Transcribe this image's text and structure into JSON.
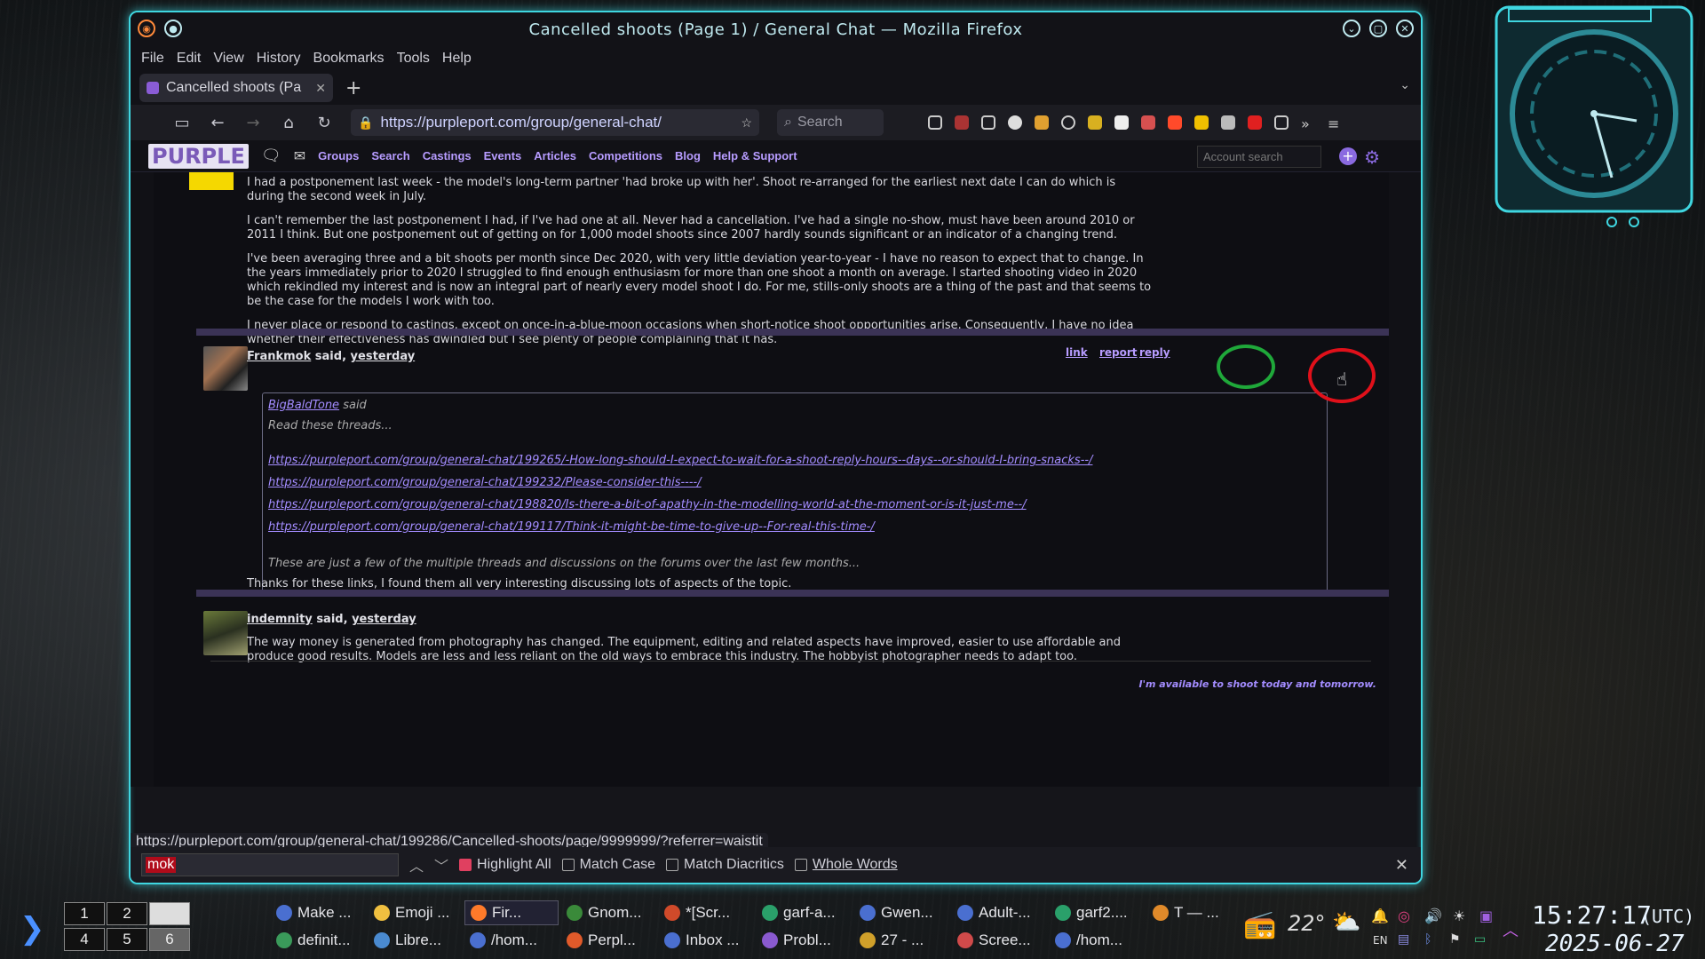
{
  "window": {
    "title": "Cancelled shoots (Page 1) / General Chat — Mozilla Firefox",
    "menu": [
      "File",
      "Edit",
      "View",
      "History",
      "Bookmarks",
      "Tools",
      "Help"
    ],
    "tab_label": "Cancelled shoots (Pa",
    "url": "https://purpleport.com/group/general-chat/",
    "search_placeholder": "Search"
  },
  "site": {
    "logo": "PURPLE",
    "nav": [
      "Groups",
      "Search",
      "Castings",
      "Events",
      "Articles",
      "Competitions",
      "Blog",
      "Help & Support"
    ],
    "account_search_placeholder": "Account search"
  },
  "post1": {
    "paragraphs": [
      "I had a postponement last week - the model's long-term partner 'had broke up with her'. Shoot re-arranged for the earliest next date I can do which is during the second week in July.",
      "I can't remember the last postponement I had, if I've had one at all. Never had a cancellation. I've had a single no-show, must have been around 2010 or 2011 I think. But one postponement out of getting on for 1,000 model shoots since 2007 hardly sounds significant or an indicator of a changing trend.",
      "I've been averaging three and a bit shoots per month since Dec 2020, with very little deviation year-to-year - I have no reason to expect that to change. In the years immediately prior to 2020 I struggled to find enough enthusiasm for more than one shoot a month on average. I started shooting video in 2020 which rekindled my interest and is now an integral part of nearly every model shoot I do. For me, stills-only shoots are a thing of the past and that seems to be the case for the models I work with too.",
      "I never place or respond to castings, except on once-in-a-blue-moon occasions when short-notice shoot opportunities arise. Consequently, I have no idea whether their effectiveness has dwindled but I see plenty of people complaining that it has."
    ]
  },
  "post2": {
    "author": "Frankmok",
    "said": "said,",
    "when": "yesterday",
    "actions": {
      "link": "link",
      "report": "report",
      "reply": "reply"
    },
    "quote": {
      "author": "BigBaldTone",
      "said": "said",
      "intro": "Read these threads...",
      "links": [
        "https://purpleport.com/group/general-chat/199265/-How-long-should-I-expect-to-wait-for-a-shoot-reply-hours--days--or-should-I-bring-snacks--/",
        "https://purpleport.com/group/general-chat/199232/Please-consider-this----/",
        "https://purpleport.com/group/general-chat/198820/Is-there-a-bit-of-apathy-in-the-modelling-world-at-the-moment-or-is-it-just-me--/",
        "https://purpleport.com/group/general-chat/199117/Think-it-might-be-time-to-give-up--For-real-this-time-/"
      ],
      "outro": "These are just a few of the multiple threads and discussions on the forums over the last few months..."
    },
    "body": "Thanks for these links, I found them all very interesting discussing lots of aspects of the topic."
  },
  "post3": {
    "author": "indemnity",
    "said": "said,",
    "when": "yesterday",
    "body": "The way money is generated from photography has changed. The equipment, editing and related aspects have improved, easier to use affordable and produce good results. Models are less and less reliant on the old ways to embrace this industry. The hobbyist photographer needs to adapt too.",
    "signature": "I'm available to shoot today and tomorrow."
  },
  "status_url": "https://purpleport.com/group/general-chat/199286/Cancelled-shoots/page/9999999/?referrer=waistit",
  "findbar": {
    "query": "mok",
    "highlight_all": "Highlight All",
    "match_case": "Match Case",
    "match_diacritics": "Match Diacritics",
    "whole_words": "Whole Words"
  },
  "taskbar": {
    "workspaces": [
      "1",
      "2",
      "",
      "4",
      "5",
      "6"
    ],
    "tasks_row1": [
      "Make ...",
      "Emoji ...",
      "Fir...",
      "Gnom...",
      "*[Scr...",
      "garf-a...",
      "Gwen...",
      "Adult-...",
      "garf2....",
      "T — ..."
    ],
    "tasks_row2": [
      "definit...",
      "Libre...",
      "/hom...",
      "Perpl...",
      "Inbox ...",
      "Probl...",
      "27 - ...",
      "Scree...",
      "/hom..."
    ],
    "weather": "22°",
    "lang": "EN",
    "clock_time": "15:27:17",
    "clock_zone": "(UTC)",
    "clock_date": "2025-06-27"
  },
  "colors": {
    "accent_cyan": "#3fd6e0",
    "site_purple": "#b79cff",
    "circle_green": "#1fa83a",
    "circle_red": "#e0101a"
  }
}
